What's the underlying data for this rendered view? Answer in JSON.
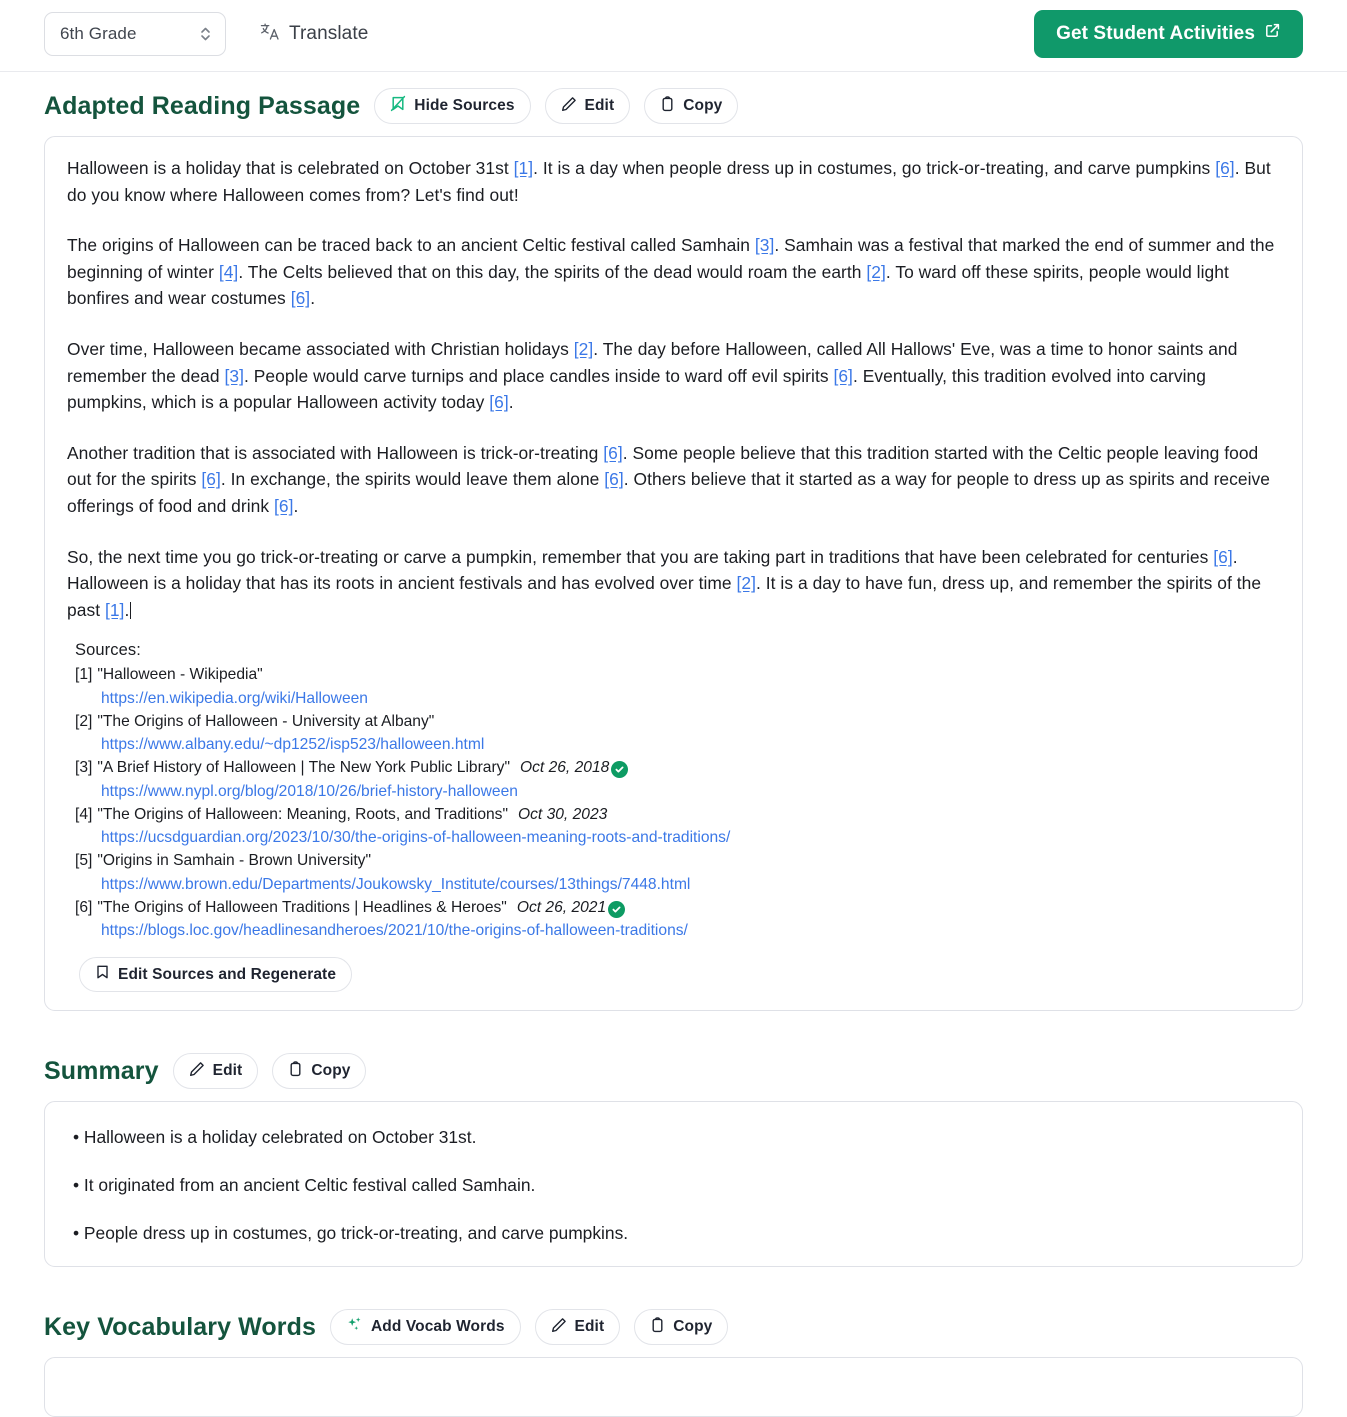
{
  "toolbar": {
    "grade_value": "6th Grade",
    "translate_label": "Translate",
    "primary_button": "Get Student Activities",
    "primary_color": "#10996a"
  },
  "passage_section": {
    "title": "Adapted Reading Passage",
    "hide_sources_label": "Hide Sources",
    "edit_label": "Edit",
    "copy_label": "Copy",
    "paragraphs": [
      {
        "runs": [
          {
            "t": "Halloween is a holiday that is celebrated on October 31st "
          },
          {
            "t": "[1]",
            "cite": true
          },
          {
            "t": ". It is a day when people dress up in costumes, go trick-or-treating, and carve pumpkins "
          },
          {
            "t": "[6]",
            "cite": true
          },
          {
            "t": ". But do you know where Halloween comes from? Let's find out!"
          }
        ]
      },
      {
        "runs": [
          {
            "t": "The origins of Halloween can be traced back to an ancient Celtic festival called Samhain "
          },
          {
            "t": "[3]",
            "cite": true
          },
          {
            "t": ". Samhain was a festival that marked the end of summer and the beginning of winter "
          },
          {
            "t": "[4]",
            "cite": true
          },
          {
            "t": ". The Celts believed that on this day, the spirits of the dead would roam the earth "
          },
          {
            "t": "[2]",
            "cite": true
          },
          {
            "t": ". To ward off these spirits, people would light bonfires and wear costumes "
          },
          {
            "t": "[6]",
            "cite": true
          },
          {
            "t": "."
          }
        ]
      },
      {
        "runs": [
          {
            "t": "Over time, Halloween became associated with Christian holidays "
          },
          {
            "t": "[2]",
            "cite": true
          },
          {
            "t": ". The day before Halloween, called All Hallows' Eve, was a time to honor saints and remember the dead "
          },
          {
            "t": "[3]",
            "cite": true
          },
          {
            "t": ". People would carve turnips and place candles inside to ward off evil spirits "
          },
          {
            "t": "[6]",
            "cite": true
          },
          {
            "t": ". Eventually, this tradition evolved into carving pumpkins, which is a popular Halloween activity today "
          },
          {
            "t": "[6]",
            "cite": true
          },
          {
            "t": "."
          }
        ]
      },
      {
        "runs": [
          {
            "t": "Another tradition that is associated with Halloween is trick-or-treating "
          },
          {
            "t": "[6]",
            "cite": true
          },
          {
            "t": ". Some people believe that this tradition started with the Celtic people leaving food out for the spirits "
          },
          {
            "t": "[6]",
            "cite": true
          },
          {
            "t": ". In exchange, the spirits would leave them alone "
          },
          {
            "t": "[6]",
            "cite": true
          },
          {
            "t": ". Others believe that it started as a way for people to dress up as spirits and receive offerings of food and drink "
          },
          {
            "t": "[6]",
            "cite": true
          },
          {
            "t": "."
          }
        ]
      },
      {
        "runs": [
          {
            "t": "So, the next time you go trick-or-treating or carve a pumpkin, remember that you are taking part in traditions that have been celebrated for centuries "
          },
          {
            "t": "[6]",
            "cite": true
          },
          {
            "t": ". Halloween is a holiday that has its roots in ancient festivals and has evolved over time "
          },
          {
            "t": "[2]",
            "cite": true
          },
          {
            "t": ". It is a day to have fun, dress up, and remember the spirits of the past "
          },
          {
            "t": "[1]",
            "cite": true
          },
          {
            "t": "."
          }
        ],
        "caret": true
      }
    ],
    "sources_label": "Sources:",
    "sources": [
      {
        "num": "[1]",
        "title": "\"Halloween - Wikipedia\"",
        "date": "",
        "verified": false,
        "url": "https://en.wikipedia.org/wiki/Halloween"
      },
      {
        "num": "[2]",
        "title": "\"The Origins of Halloween - University at Albany\"",
        "date": "",
        "verified": false,
        "url": "https://www.albany.edu/~dp1252/isp523/halloween.html"
      },
      {
        "num": "[3]",
        "title": "\"A Brief History of Halloween | The New York Public Library\"",
        "date": "Oct 26, 2018",
        "verified": true,
        "url": "https://www.nypl.org/blog/2018/10/26/brief-history-halloween"
      },
      {
        "num": "[4]",
        "title": "\"The Origins of Halloween: Meaning, Roots, and Traditions\"",
        "date": "Oct 30, 2023",
        "verified": false,
        "url": "https://ucsdguardian.org/2023/10/30/the-origins-of-halloween-meaning-roots-and-traditions/"
      },
      {
        "num": "[5]",
        "title": "\"Origins in Samhain - Brown University\"",
        "date": "",
        "verified": false,
        "url": "https://www.brown.edu/Departments/Joukowsky_Institute/courses/13things/7448.html"
      },
      {
        "num": "[6]",
        "title": "\"The Origins of Halloween Traditions | Headlines & Heroes\"",
        "date": "Oct 26, 2021",
        "verified": true,
        "url": "https://blogs.loc.gov/headlinesandheroes/2021/10/the-origins-of-halloween-traditions/"
      }
    ],
    "edit_sources_label": "Edit Sources and Regenerate"
  },
  "summary_section": {
    "title": "Summary",
    "edit_label": "Edit",
    "copy_label": "Copy",
    "bullets": [
      "• Halloween is a holiday celebrated on October 31st.",
      "• It originated from an ancient Celtic festival called Samhain.",
      "• People dress up in costumes, go trick-or-treating, and carve pumpkins."
    ]
  },
  "vocab_section": {
    "title": "Key Vocabulary Words",
    "add_label": "Add Vocab Words",
    "edit_label": "Edit",
    "copy_label": "Copy"
  }
}
